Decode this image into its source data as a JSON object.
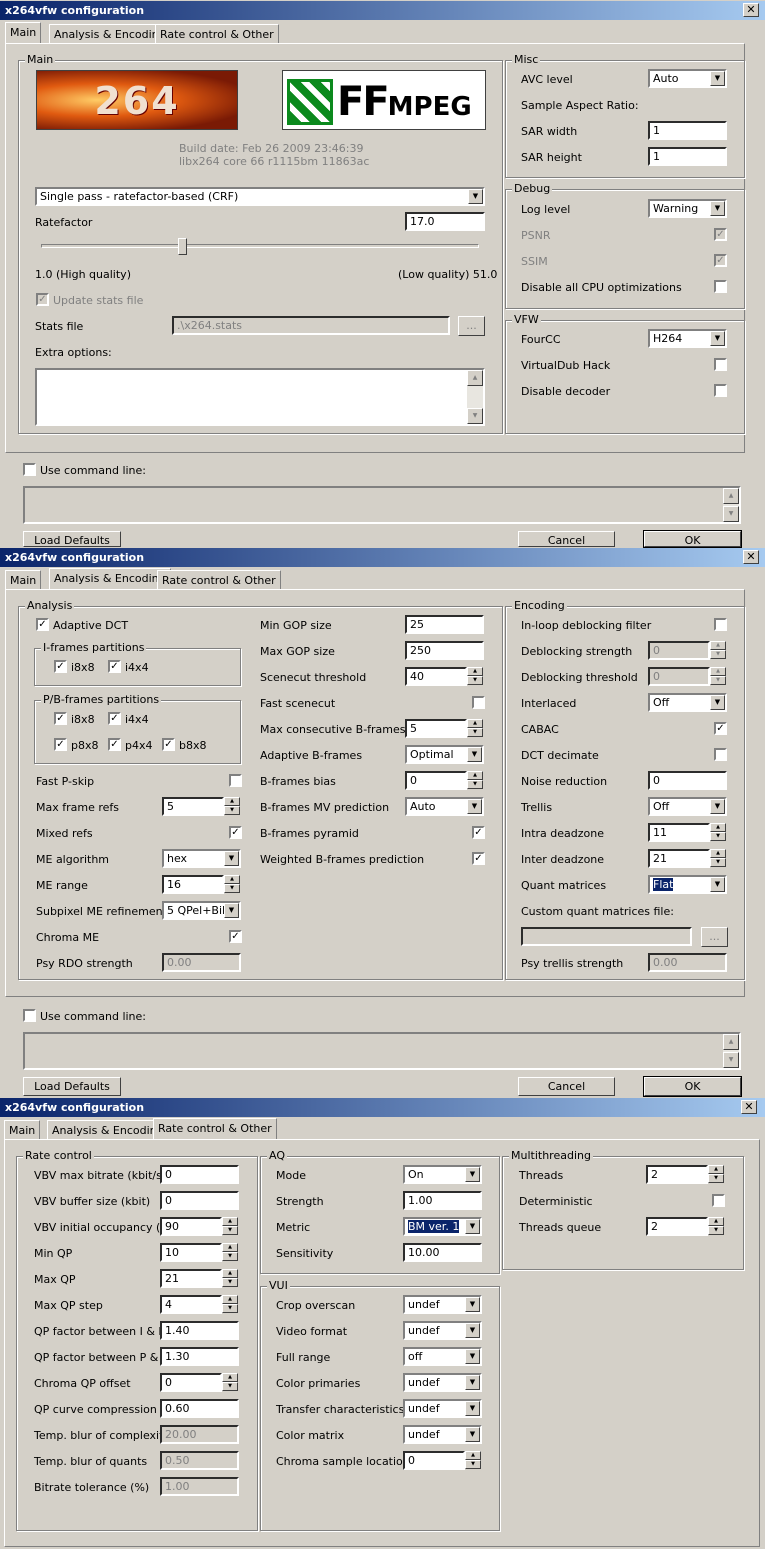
{
  "window_title": "x264vfw configuration",
  "close_glyph": "✕",
  "tabs": {
    "main": "Main",
    "analysis": "Analysis & Encoding",
    "rate": "Rate control & Other"
  },
  "bottom": {
    "use_cmd": "Use command line:",
    "load": "Load Defaults",
    "cancel": "Cancel",
    "ok": "OK"
  },
  "p1": {
    "main_group": "Main",
    "logo_text": "264",
    "ff_logo_big": "FF",
    "ff_logo_small": "MPEG",
    "build_date": "Build date: Feb 26 2009 23:46:39",
    "build_core": "libx264 core 66 r1115bm 11863ac",
    "mode": "Single pass - ratefactor-based (CRF)",
    "ratefactor_label": "Ratefactor",
    "ratefactor_value": "17.0",
    "ratefactor_level": 0.32,
    "hq": "1.0 (High quality)",
    "lq": "(Low quality) 51.0",
    "update_stats": "Update stats file",
    "stats_file_label": "Stats file",
    "stats_file_value": ".\\x264.stats",
    "browse": "...",
    "extra": "Extra options:",
    "misc_group": "Misc",
    "avc_level_label": "AVC level",
    "avc_level": "Auto",
    "sar_label": "Sample Aspect Ratio:",
    "sar_w_label": "SAR width",
    "sar_w": "1",
    "sar_h_label": "SAR height",
    "sar_h": "1",
    "debug_group": "Debug",
    "log_level_label": "Log level",
    "log_level": "Warning",
    "psnr": "PSNR",
    "ssim": "SSIM",
    "disable_cpu": "Disable all CPU optimizations",
    "vfw_group": "VFW",
    "fourcc_label": "FourCC",
    "fourcc": "H264",
    "vdub": "VirtualDub Hack",
    "disable_decoder": "Disable decoder"
  },
  "p2": {
    "analysis_group": "Analysis",
    "adaptive_dct": "Adaptive DCT",
    "iframes": "I-frames partitions",
    "pb": "P/B-frames partitions",
    "i8x8": "i8x8",
    "i4x4": "i4x4",
    "p8x8": "p8x8",
    "p4x4": "p4x4",
    "b8x8": "b8x8",
    "fast_pskip": "Fast P-skip",
    "max_refs_label": "Max frame refs",
    "max_refs": "5",
    "mixed_refs": "Mixed refs",
    "me_alg_label": "ME algorithm",
    "me_alg": "hex",
    "me_range_label": "ME range",
    "me_range": "16",
    "subme_label": "Subpixel ME refinement",
    "subme": "5 QPel+BiME",
    "chroma_me": "Chroma ME",
    "psy_rdo_label": "Psy RDO strength",
    "psy_rdo": "0.00",
    "min_gop_label": "Min GOP size",
    "min_gop": "25",
    "max_gop_label": "Max GOP size",
    "max_gop": "250",
    "scenecut_label": "Scenecut threshold",
    "scenecut": "40",
    "fast_scenecut": "Fast scenecut",
    "max_b_label": "Max consecutive B-frames",
    "max_b": "5",
    "adapt_b_label": "Adaptive B-frames",
    "adapt_b": "Optimal",
    "b_bias_label": "B-frames bias",
    "b_bias": "0",
    "b_mv_label": "B-frames MV prediction",
    "b_mv": "Auto",
    "b_pyramid": "B-frames pyramid",
    "weighted_b": "Weighted B-frames prediction",
    "encoding_group": "Encoding",
    "deblock": "In-loop deblocking filter",
    "db_strength_label": "Deblocking strength",
    "db_strength": "0",
    "db_thresh_label": "Deblocking threshold",
    "db_thresh": "0",
    "interlaced_label": "Interlaced",
    "interlaced": "Off",
    "cabac": "CABAC",
    "dct_decimate": "DCT decimate",
    "noise_label": "Noise reduction",
    "noise": "0",
    "trellis_label": "Trellis",
    "trellis": "Off",
    "intra_dz_label": "Intra deadzone",
    "intra_dz": "11",
    "inter_dz_label": "Inter deadzone",
    "inter_dz": "21",
    "quant_label": "Quant matrices",
    "quant": "Flat",
    "custom_quant": "Custom quant matrices file:",
    "browse": "...",
    "psy_trellis_label": "Psy trellis strength",
    "psy_trellis": "0.00"
  },
  "p3": {
    "rc_group": "Rate control",
    "vbv_max_label": "VBV max bitrate (kbit/s)",
    "vbv_max": "0",
    "vbv_buf_label": "VBV buffer size (kbit)",
    "vbv_buf": "0",
    "vbv_init_label": "VBV initial occupancy (%)",
    "vbv_init": "90",
    "min_qp_label": "Min QP",
    "min_qp": "10",
    "max_qp_label": "Max QP",
    "max_qp": "21",
    "max_qp_step_label": "Max QP step",
    "max_qp_step": "4",
    "ipratio_label": "QP factor between I & P",
    "ipratio": "1.40",
    "pbratio_label": "QP factor between P & B",
    "pbratio": "1.30",
    "chroma_qp_label": "Chroma QP offset",
    "chroma_qp": "0",
    "qcomp_label": "QP curve compression",
    "qcomp": "0.60",
    "cplx_blur_label": "Temp. blur of complexity",
    "cplx_blur": "20.00",
    "quant_blur_label": "Temp. blur of quants",
    "quant_blur": "0.50",
    "br_tol_label": "Bitrate tolerance (%)",
    "br_tol": "1.00",
    "aq_group": "AQ",
    "aq_mode_label": "Mode",
    "aq_mode": "On",
    "aq_str_label": "Strength",
    "aq_str": "1.00",
    "aq_metric_label": "Metric",
    "aq_metric": "BM ver. 1",
    "aq_sens_label": "Sensitivity",
    "aq_sens": "10.00",
    "mt_group": "Multithreading",
    "threads_label": "Threads",
    "threads": "2",
    "deterministic": "Deterministic",
    "tq_label": "Threads queue",
    "tq": "2",
    "vui_group": "VUI",
    "crop_label": "Crop overscan",
    "crop": "undef",
    "vfmt_label": "Video format",
    "vfmt": "undef",
    "frange_label": "Full range",
    "frange": "off",
    "cprim_label": "Color primaries",
    "cprim": "undef",
    "trans_label": "Transfer characteristics",
    "trans": "undef",
    "cmatrix_label": "Color matrix",
    "cmatrix": "undef",
    "chromaloc_label": "Chroma sample location",
    "chromaloc": "0"
  },
  "glyph": {
    "check": "✓",
    "down": "▼",
    "up": "▲"
  }
}
